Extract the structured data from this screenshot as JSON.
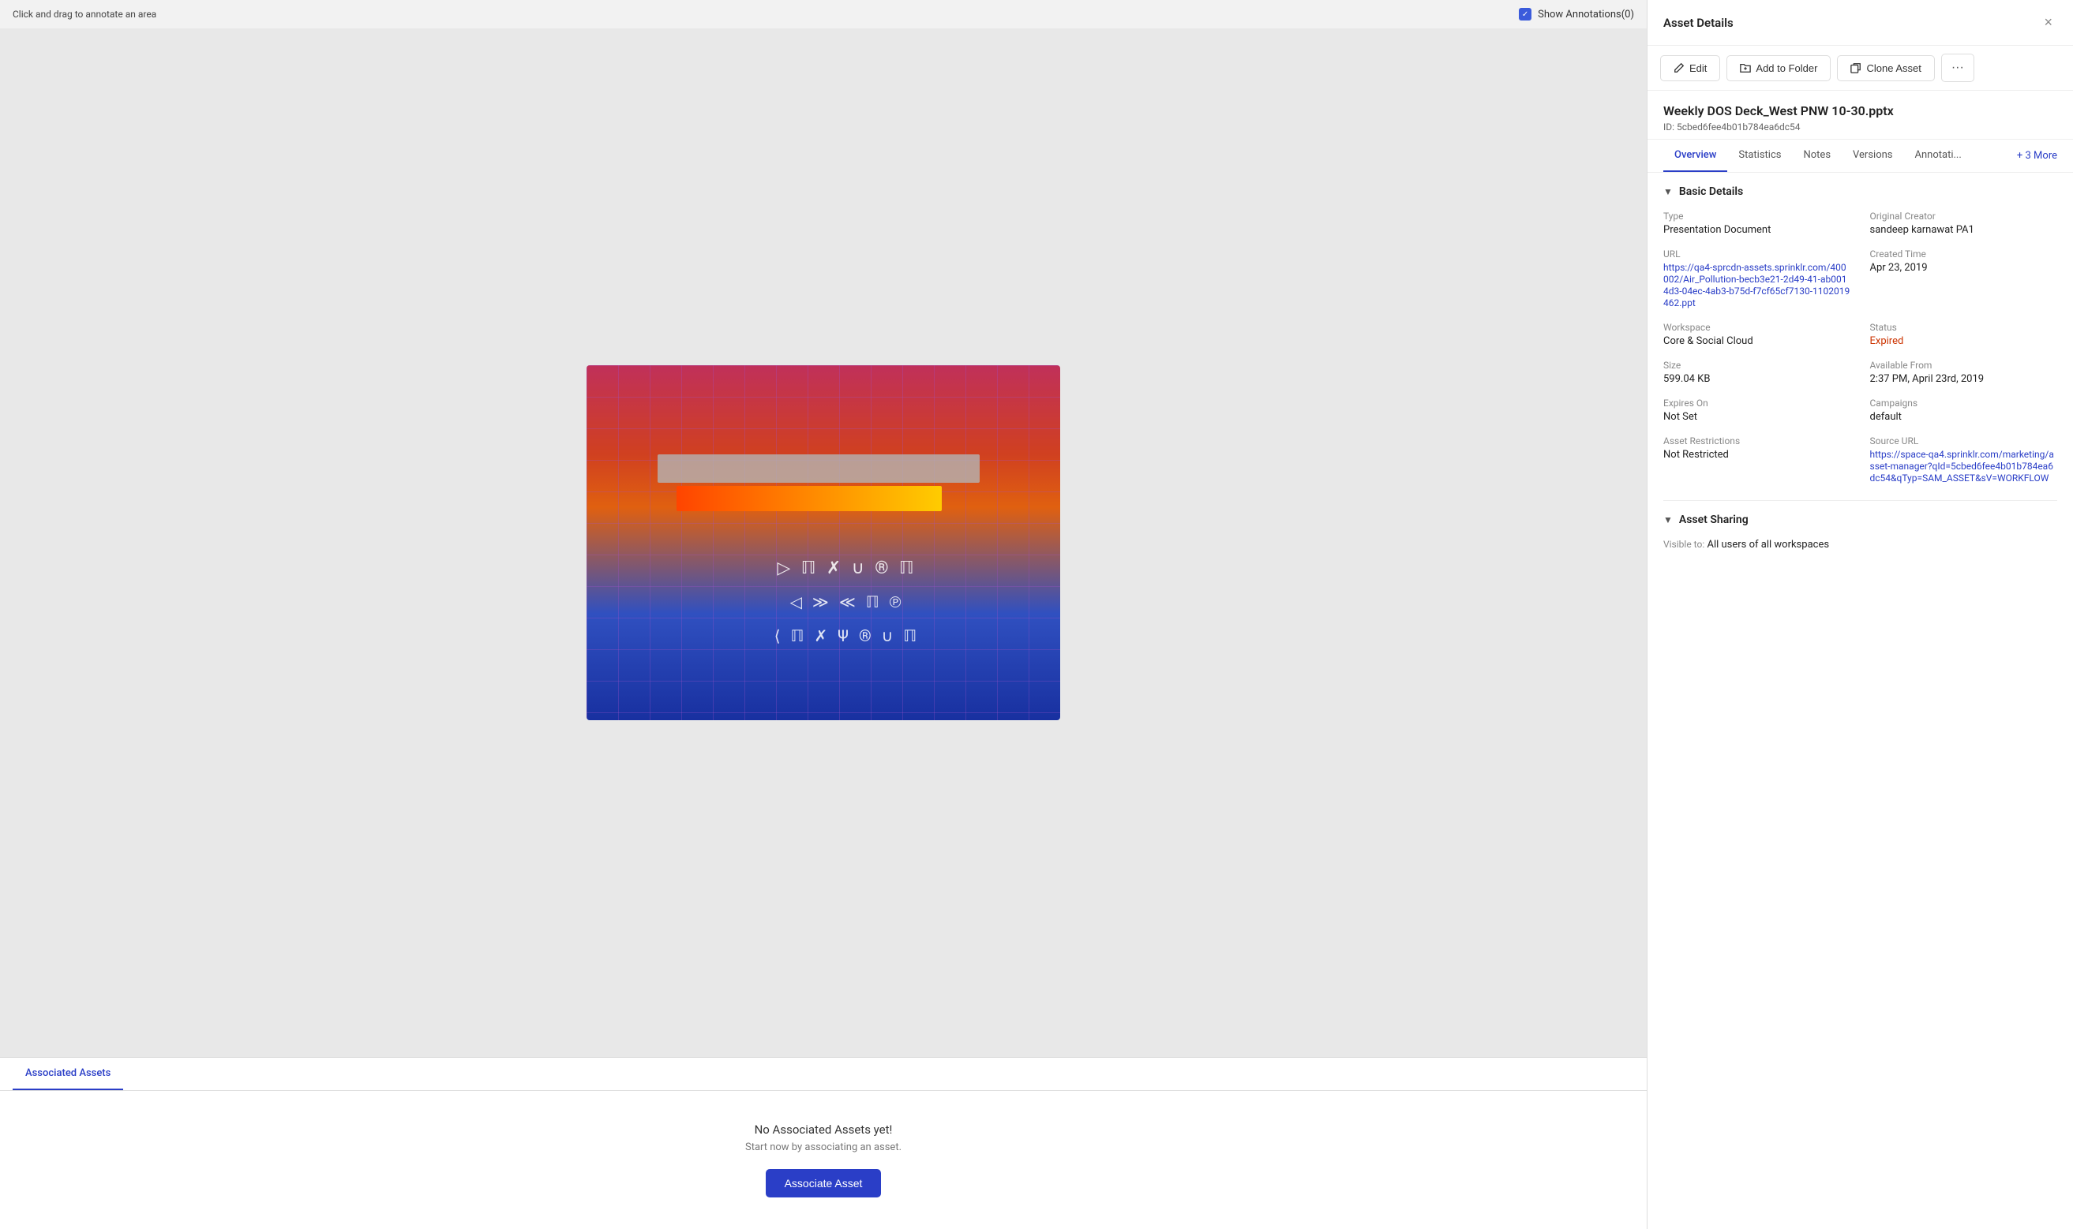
{
  "annotation_bar": {
    "drag_hint": "Click and drag to annotate an area",
    "show_annotations_label": "Show Annotations(0)",
    "checkbox_checked": true
  },
  "asset_image": {
    "alt": "Weekly DOS Deck West PNW slide preview"
  },
  "bottom_tabs": [
    {
      "label": "Associated Assets",
      "active": true
    }
  ],
  "associated_assets": {
    "empty_title": "No Associated Assets yet!",
    "empty_subtitle": "Start now by associating an asset.",
    "button_label": "Associate Asset"
  },
  "right_panel": {
    "title": "Asset Details",
    "close_label": "×"
  },
  "action_bar": {
    "edit_label": "Edit",
    "add_folder_label": "Add to Folder",
    "clone_label": "Clone Asset",
    "more_label": "···"
  },
  "asset_info": {
    "title": "Weekly DOS Deck_West PNW 10-30.pptx",
    "id_label": "ID: 5cbed6fee4b01b784ea6dc54"
  },
  "detail_tabs": [
    {
      "label": "Overview",
      "active": true
    },
    {
      "label": "Statistics",
      "active": false
    },
    {
      "label": "Notes",
      "active": false
    },
    {
      "label": "Versions",
      "active": false
    },
    {
      "label": "Annotati...",
      "active": false
    }
  ],
  "more_tabs_label": "+ 3 More",
  "basic_details": {
    "section_title": "Basic Details",
    "fields": {
      "type_label": "Type",
      "type_value": "Presentation Document",
      "original_creator_label": "Original Creator",
      "original_creator_value": "sandeep karnawat PA1",
      "url_label": "URL",
      "url_value": "https://qa4-sprcdn-assets.sprinklr.com/400002/Air_Pollution-becb3e21-2d49-41-ab0014d3-04ec-4ab3-b75d-f7cf65cf7130-1102019462.ppt",
      "created_time_label": "Created Time",
      "created_time_value": "Apr 23, 2019",
      "workspace_label": "Workspace",
      "workspace_value": "Core & Social Cloud",
      "status_label": "Status",
      "status_value": "Expired",
      "size_label": "Size",
      "size_value": "599.04 KB",
      "available_from_label": "Available From",
      "available_from_value": "2:37 PM, April 23rd, 2019",
      "expires_on_label": "Expires On",
      "expires_on_value": "Not Set",
      "campaigns_label": "Campaigns",
      "campaigns_value": "default",
      "asset_restrictions_label": "Asset Restrictions",
      "asset_restrictions_value": "Not Restricted",
      "source_url_label": "Source URL",
      "source_url_value": "https://space-qa4.sprinklr.com/marketing/asset-manager?qId=5cbed6fee4b01b784ea6dc54&qTyp=SAM_ASSET&sV=WORKFLOW"
    }
  },
  "asset_sharing": {
    "section_title": "Asset Sharing",
    "visible_to_label": "Visible to:",
    "visible_to_value": "All users of all workspaces"
  }
}
